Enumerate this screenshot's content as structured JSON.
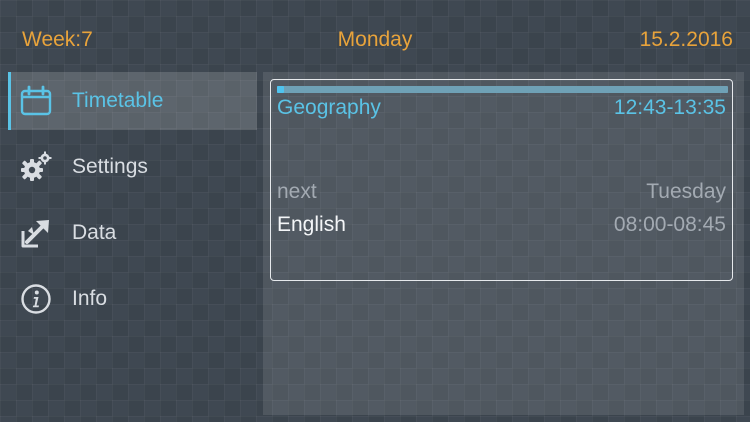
{
  "header": {
    "week": "Week:7",
    "day": "Monday",
    "date": "15.2.2016"
  },
  "colors": {
    "accent": "#5ac3e6",
    "header_text": "#e8a33b",
    "progress_track": "#6fa1b6",
    "progress_fill": "#4fc3ee"
  },
  "sidebar": {
    "items": [
      {
        "label": "Timetable",
        "icon": "calendar-icon",
        "active": true
      },
      {
        "label": "Settings",
        "icon": "gears-icon",
        "active": false
      },
      {
        "label": "Data",
        "icon": "export-arrow-icon",
        "active": false
      },
      {
        "label": "Info",
        "icon": "info-icon",
        "active": false
      }
    ]
  },
  "current": {
    "subject": "Geography",
    "time": "12:43-13:35",
    "progress_fraction": 0.015
  },
  "next": {
    "label": "next",
    "day": "Tuesday",
    "subject": "English",
    "time": "08:00-08:45"
  }
}
